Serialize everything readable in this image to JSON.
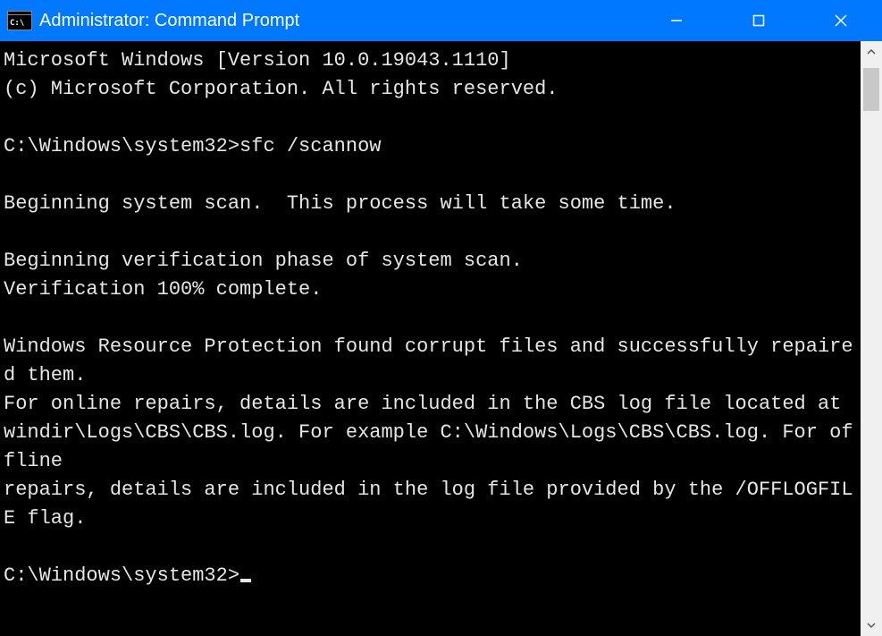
{
  "titlebar": {
    "title": "Administrator: Command Prompt"
  },
  "terminal": {
    "lines": [
      "Microsoft Windows [Version 10.0.19043.1110]",
      "(c) Microsoft Corporation. All rights reserved.",
      "",
      "C:\\Windows\\system32>sfc /scannow",
      "",
      "Beginning system scan.  This process will take some time.",
      "",
      "Beginning verification phase of system scan.",
      "Verification 100% complete.",
      "",
      "Windows Resource Protection found corrupt files and successfully repaired them.",
      "For online repairs, details are included in the CBS log file located at",
      "windir\\Logs\\CBS\\CBS.log. For example C:\\Windows\\Logs\\CBS\\CBS.log. For offline",
      "repairs, details are included in the log file provided by the /OFFLOGFILE flag.",
      ""
    ],
    "prompt": "C:\\Windows\\system32>"
  }
}
